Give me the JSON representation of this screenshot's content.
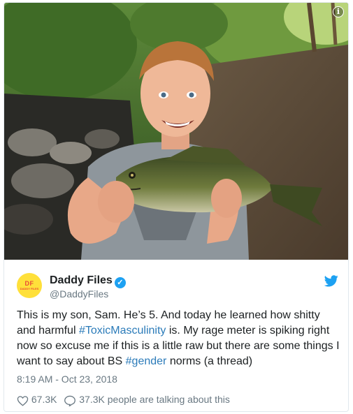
{
  "tweet": {
    "author_name": "Daddy Files",
    "handle": "@DaddyFiles",
    "avatar_logo": "DF",
    "avatar_sub": "DADDY FILES",
    "text_parts": {
      "p1": "This is my son, Sam. He’s 5. And today he learned how shitty and harmful ",
      "tag1": "#ToxicMasculinity",
      "p2": " is. My rage meter is spiking right now so excuse me if this is a little raw but there are some things I want to say about BS ",
      "tag2": "#gender",
      "p3": " norms (a thread)"
    },
    "timestamp": "8:19 AM - Oct 23, 2018",
    "likes": "67.3K",
    "replies_text": "37.3K people are talking about this"
  },
  "icons": {
    "info": "info-icon",
    "verified": "verified-badge-icon",
    "brand": "twitter-bird-icon",
    "like": "heart-icon",
    "reply": "speech-bubble-icon"
  },
  "colors": {
    "link": "#2b7bb9",
    "brand_blue": "#1da1f2",
    "muted": "#697882",
    "avatar_bg": "#ffe03a"
  }
}
